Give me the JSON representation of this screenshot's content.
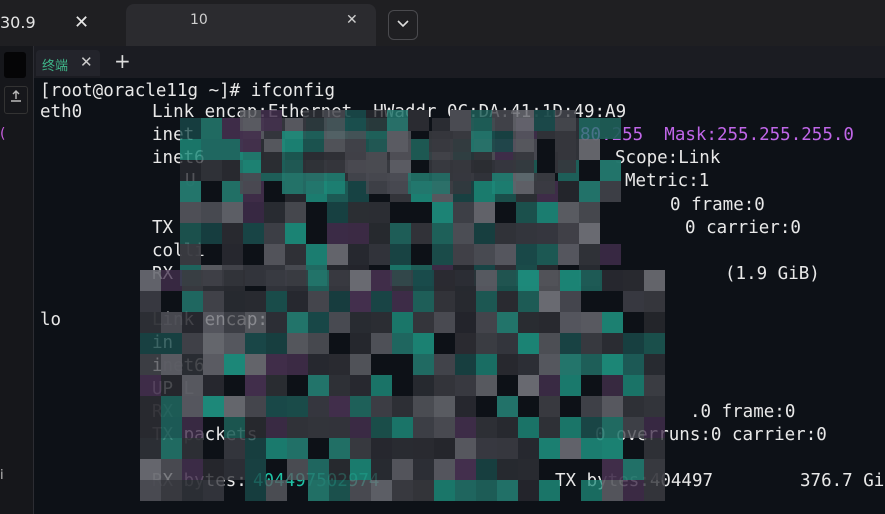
{
  "browser": {
    "tab_left_title": "30.9",
    "tab_left_close": "✕",
    "tab_active_title": "10",
    "tab_active_close": "✕",
    "dropdown_icon": "chevron-down-icon"
  },
  "sidebar": {
    "upload_icon": "upload-icon",
    "mark_top": "(",
    "mark_bottom": "i"
  },
  "terminal_tabs": {
    "tab_label": "终端",
    "tab_close": "✕",
    "new_tab": "+"
  },
  "terminal": {
    "prompt": "[root@oracle11g ~]# ifconfig",
    "eth0": {
      "iface": "eth0",
      "l1": "Link encap:Ethernet  HWaddr 0C:DA:41:1D:49:A9",
      "l2_a": "inet",
      "l2_b": "80.255  Mask:255.255.255.0",
      "l3_a": "inet6",
      "l3_b": "Scope:Link",
      "l4_a": "U",
      "l4_b": "Metric:1",
      "l5_b": "0 frame:0",
      "l6_a": "TX",
      "l6_b": "0 carrier:0",
      "l7_a": "colli",
      "l8_a": "RX",
      "l8_b": "(1.9 GiB)"
    },
    "lo": {
      "iface": "lo",
      "l1": "Link encap:",
      "l2_a": "in",
      "l3_a": "inet6",
      "l4_a": "UP L",
      "l5_a": "RX",
      "l5_b": ".0 frame:0",
      "l6_a": "TX packets",
      "l6_b": "0 overruns:0 carrier:0",
      "l8_a": "RX bytes:",
      "l8_b": "404497502974",
      "l8_c": "TX bytes:404497",
      "l8_d": "376.7 Gi"
    }
  },
  "colors": {
    "background": "#0d1117",
    "purple": "#c066e8",
    "teal": "#1fc3a5",
    "tab_green": "#3fb78a"
  }
}
